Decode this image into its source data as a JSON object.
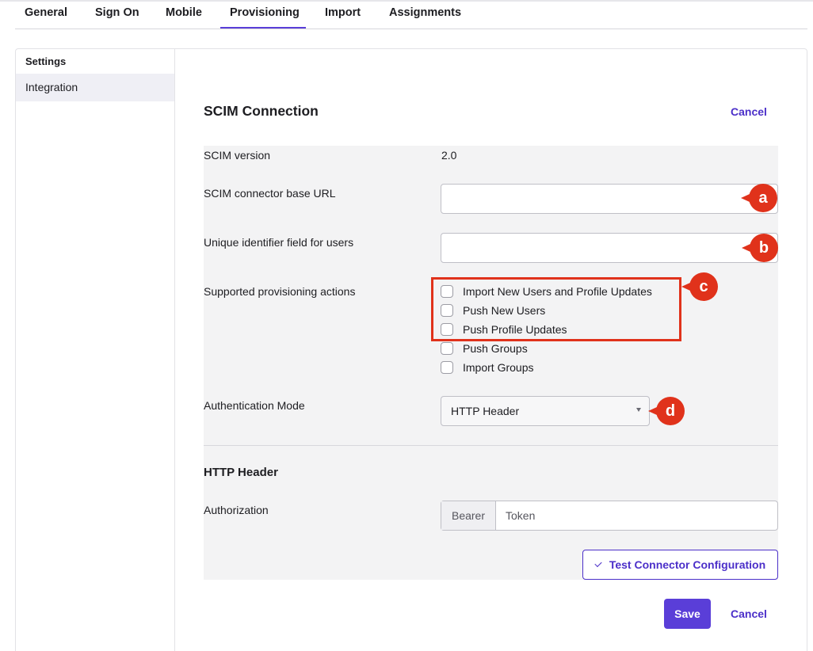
{
  "tabs": [
    {
      "label": "General"
    },
    {
      "label": "Sign On"
    },
    {
      "label": "Mobile"
    },
    {
      "label": "Provisioning",
      "active": true
    },
    {
      "label": "Import"
    },
    {
      "label": "Assignments"
    }
  ],
  "sidebar": {
    "title": "Settings",
    "items": [
      {
        "label": "Integration",
        "selected": true
      }
    ]
  },
  "section": {
    "title": "SCIM Connection",
    "cancel_label": "Cancel"
  },
  "form": {
    "scim_version": {
      "label": "SCIM version",
      "value": "2.0"
    },
    "base_url": {
      "label": "SCIM connector base URL",
      "value": ""
    },
    "unique_id": {
      "label": "Unique identifier field for users",
      "value": ""
    },
    "actions": {
      "label": "Supported provisioning actions",
      "options": [
        {
          "label": "Import New Users and Profile Updates",
          "checked": false
        },
        {
          "label": "Push New Users",
          "checked": false
        },
        {
          "label": "Push Profile Updates",
          "checked": false
        },
        {
          "label": "Push Groups",
          "checked": false
        },
        {
          "label": "Import Groups",
          "checked": false
        }
      ]
    },
    "auth_mode": {
      "label": "Authentication Mode",
      "selected": "HTTP Header"
    }
  },
  "http_header": {
    "title": "HTTP Header",
    "authorization_label": "Authorization",
    "prefix": "Bearer",
    "token_placeholder": "Token"
  },
  "buttons": {
    "test_label": "Test Connector Configuration",
    "save_label": "Save",
    "cancel_label": "Cancel"
  },
  "annotations": [
    {
      "letter": "a"
    },
    {
      "letter": "b"
    },
    {
      "letter": "c"
    },
    {
      "letter": "d"
    }
  ],
  "colors": {
    "accent": "#5a3ed8",
    "link": "#4b2fc9",
    "annotation": "#e0321b",
    "form_background": "#f3f3f4"
  }
}
